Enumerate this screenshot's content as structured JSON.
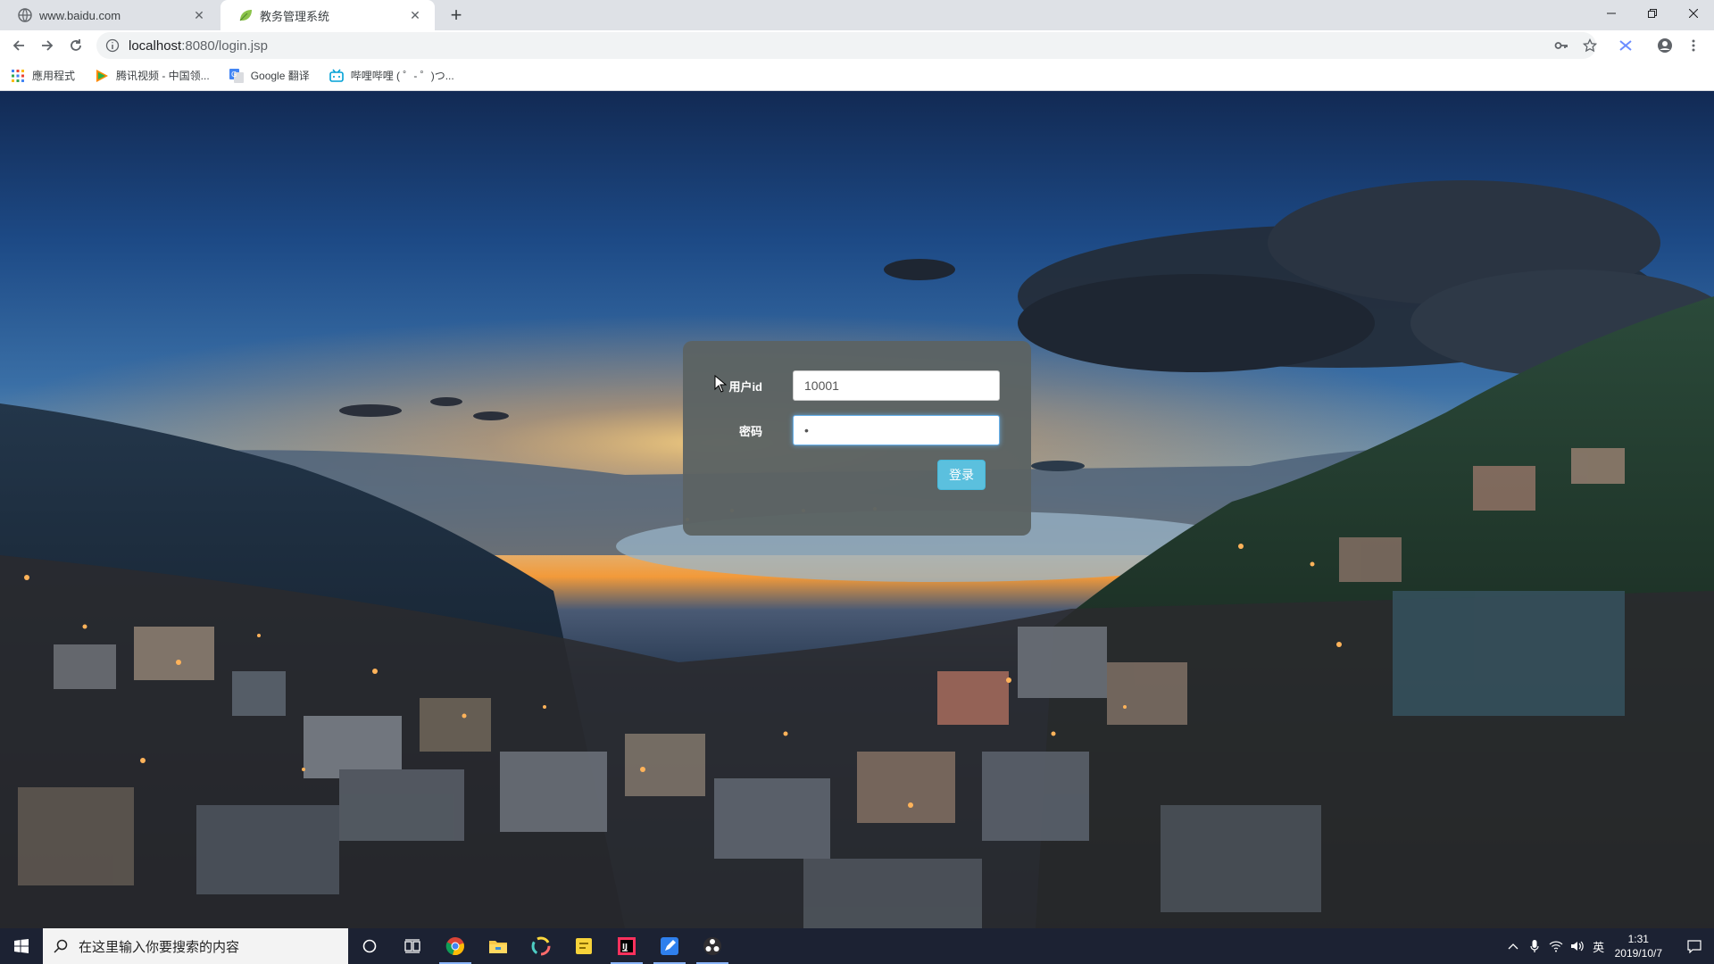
{
  "browser": {
    "tabs": [
      {
        "title": "www.baidu.com",
        "active": false
      },
      {
        "title": "教务管理系统",
        "active": true
      }
    ],
    "new_tab_label": "+",
    "url_host": "localhost",
    "url_path": ":8080/login.jsp",
    "bookmarks": [
      {
        "label": "應用程式",
        "icon": "apps-grid-icon"
      },
      {
        "label": "腾讯视频 - 中国领...",
        "icon": "tencent-video-icon"
      },
      {
        "label": "Google 翻译",
        "icon": "google-translate-icon"
      },
      {
        "label": "哔哩哔哩 ( ゜- ゜)つ...",
        "icon": "bilibili-icon"
      }
    ]
  },
  "login": {
    "userid_label": "用户id",
    "userid_value": "10001",
    "password_label": "密码",
    "password_value": "•",
    "submit_label": "登录"
  },
  "taskbar": {
    "search_placeholder": "在这里输入你要搜索的内容",
    "ime_label": "英",
    "time": "1:31",
    "date": "2019/10/7"
  },
  "colors": {
    "card_bg": "#5c6363",
    "button_bg": "#5bc0de",
    "taskbar_bg": "#1c2233"
  }
}
